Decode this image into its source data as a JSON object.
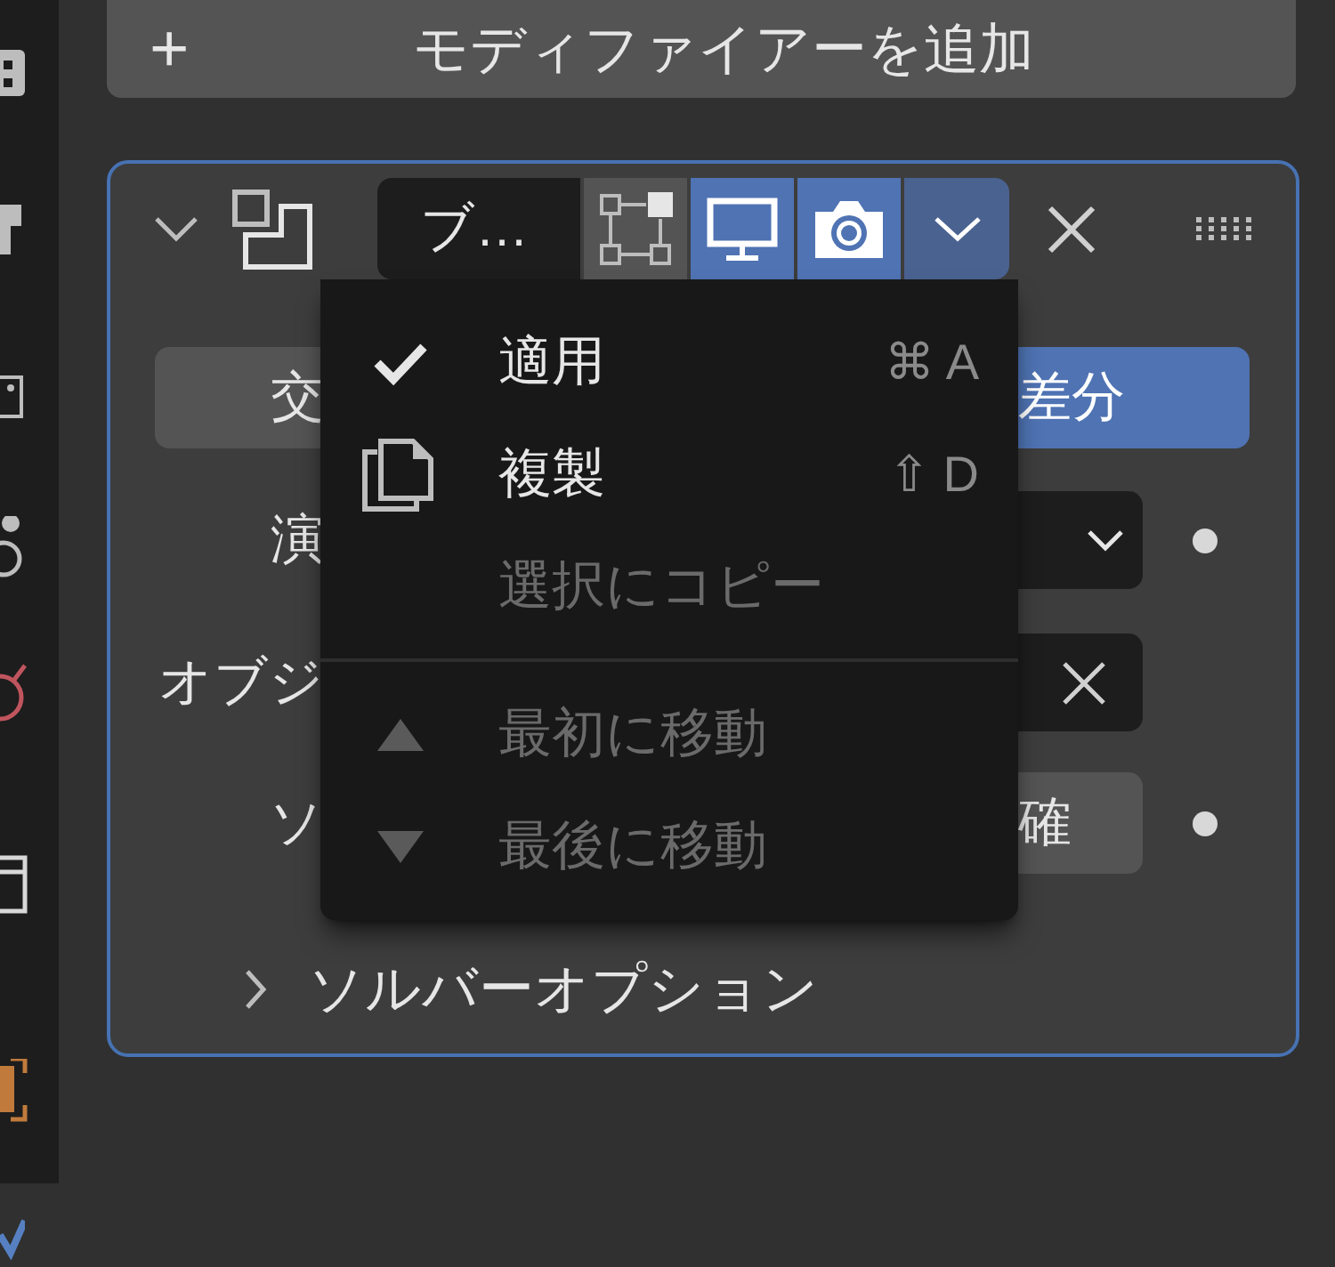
{
  "add_button": {
    "icon": "+",
    "label": "モディファイアーを追加"
  },
  "modifier": {
    "expanded": true,
    "name": "ブ…",
    "toggles": [
      {
        "kind": "edit_mode",
        "on": false
      },
      {
        "kind": "viewport",
        "on": true
      },
      {
        "kind": "render",
        "on": true
      }
    ],
    "operations": [
      {
        "label": "交",
        "selected": false
      },
      {
        "label": "差分",
        "selected": true
      }
    ],
    "rows": [
      {
        "kind": "dropdown",
        "label": "演"
      },
      {
        "kind": "object",
        "label": "オブジ"
      },
      {
        "kind": "button",
        "label": "ソ",
        "value": "確"
      }
    ],
    "solver_options": {
      "label": "ソルバーオプション",
      "expanded": false
    }
  },
  "menu": {
    "items": [
      {
        "kind": "apply",
        "label": "適用",
        "shortcut": "⌘ A",
        "disabled": false
      },
      {
        "kind": "duplicate",
        "label": "複製",
        "shortcut": "⇧ D",
        "disabled": false
      },
      {
        "kind": "copy_to_selected",
        "label": "選択にコピー",
        "disabled": true
      },
      {
        "kind": "separator"
      },
      {
        "kind": "move_first",
        "label": "最初に移動",
        "disabled": true
      },
      {
        "kind": "move_last",
        "label": "最後に移動",
        "disabled": true
      }
    ]
  }
}
